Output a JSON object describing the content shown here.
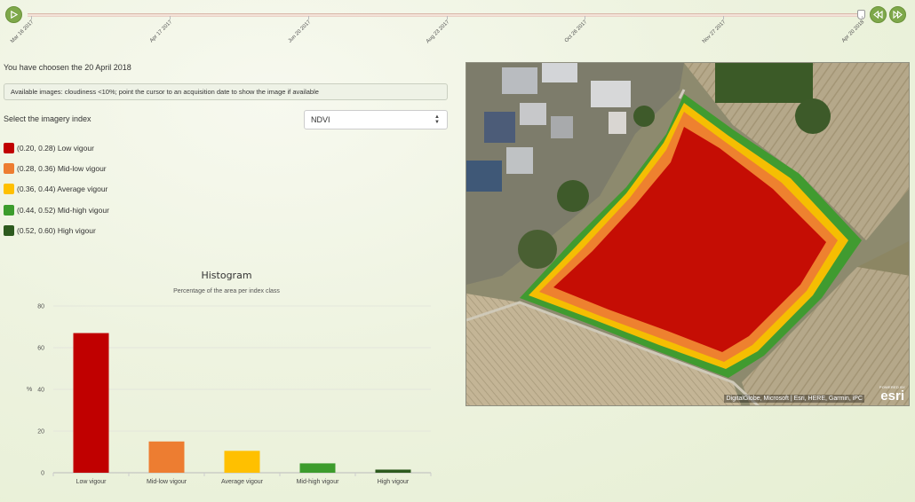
{
  "timeline": {
    "ticks": [
      "Mar 16 2017",
      "Apr 17 2017",
      "Jun 20 2017",
      "Aug 23 2017",
      "Oct 26 2017",
      "Nov 27 2017",
      "Apr 20 2018"
    ],
    "play_icon": "play-icon",
    "prev_icon": "rewind-icon",
    "next_icon": "fast-forward-icon"
  },
  "selection": {
    "chosen_text": "You have choosen the 20 April 2018",
    "info_text": "Available images: cloudiness <10%; point the cursor to an acquisition date to show the image if available",
    "index_label": "Select the imagery index",
    "index_value": "NDVI"
  },
  "legend": [
    {
      "label": "(0.20, 0.28) Low vigour",
      "color": "#c00000"
    },
    {
      "label": "(0.28, 0.36) Mid-low vigour",
      "color": "#ed7d31"
    },
    {
      "label": "(0.36, 0.44) Average vigour",
      "color": "#ffc000"
    },
    {
      "label": "(0.44, 0.52) Mid-high vigour",
      "color": "#3c9c2c"
    },
    {
      "label": "(0.52, 0.60) High vigour",
      "color": "#2d5a1e"
    }
  ],
  "chart_data": {
    "type": "bar",
    "title": "Histogram",
    "subtitle": "Percentage of the area per index class",
    "ylabel": "%",
    "xlabel": "",
    "categories": [
      "Low vigour",
      "Mid-low vigour",
      "Average vigour",
      "Mid-high vigour",
      "High vigour"
    ],
    "values": [
      67,
      15,
      10.5,
      4.5,
      1.5
    ],
    "colors": [
      "#c00000",
      "#ed7d31",
      "#ffc000",
      "#3c9c2c",
      "#2d5a1e"
    ],
    "ylim": [
      0,
      80
    ],
    "yticks": [
      0,
      20,
      40,
      60,
      80
    ],
    "grid": true
  },
  "map": {
    "attribution": "DigitalGlobe, Microsoft | Esri, HERE, Garmin, iPC",
    "powered_by": "POWERED BY",
    "logo": "esri"
  }
}
